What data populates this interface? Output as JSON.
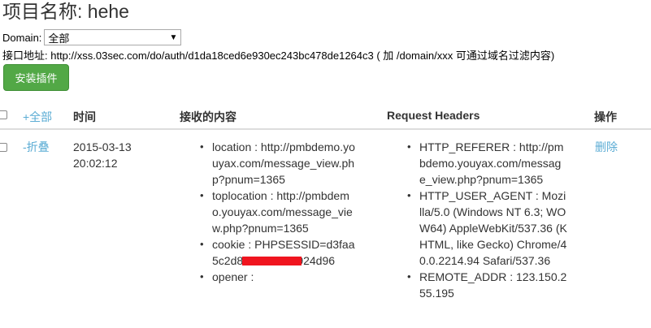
{
  "project": {
    "title": "项目名称: hehe"
  },
  "domain": {
    "label": "Domain:",
    "selected": "全部"
  },
  "api": {
    "text": "接口地址: http://xss.03sec.com/do/auth/d1da18ced6e930ec243bc478de1264c3 ( 加 /domain/xxx 可通过域名过滤内容)"
  },
  "install_button": "安装插件",
  "table": {
    "headers": {
      "expand_all": "+全部",
      "time": "时间",
      "content": "接收的内容",
      "request_headers": "Request Headers",
      "actions": "操作"
    },
    "rows": [
      {
        "toggle": "-折叠",
        "date": "2015-03-13",
        "time": "20:02:12",
        "content": [
          "location : http://pmbdemo.youyax.com/message_view.php?pnum=1365",
          "toplocation : http://pmbdemo.youyax.com/message_view.php?pnum=1365",
          "cookie : PHPSESSID=d3faa5c2d8          04d8392a924d96",
          "opener :"
        ],
        "headers": [
          "HTTP_REFERER : http://pmbdemo.youyax.com/message_view.php?pnum=1365",
          "HTTP_USER_AGENT : Mozilla/5.0 (Windows NT 6.3; WOW64) AppleWebKit/537.36 (KHTML, like Gecko) Chrome/40.0.2214.94 Safari/537.36",
          "REMOTE_ADDR : 123.150.255.195"
        ],
        "delete": "删除"
      }
    ]
  },
  "colors": {
    "link": "#5bacd4",
    "button": "#52a846",
    "redaction": "#f0151f"
  }
}
